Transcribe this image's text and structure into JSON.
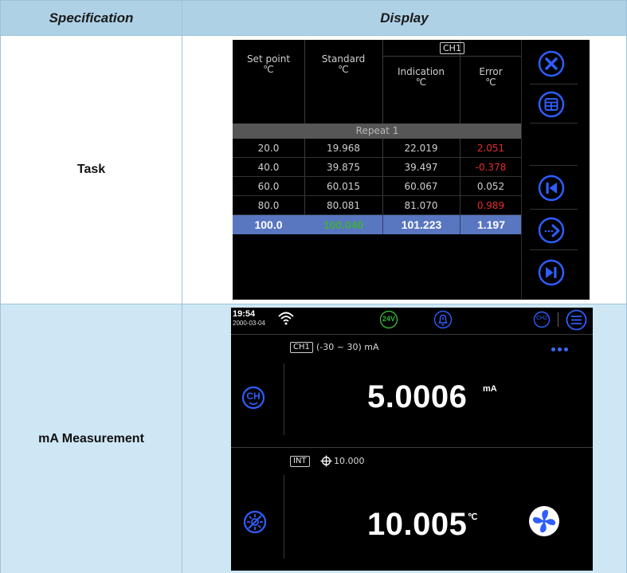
{
  "table": {
    "header_spec": "Specification",
    "header_display": "Display",
    "row1_label": "Task",
    "row2_label": "mA Measurement"
  },
  "task": {
    "columns": {
      "setpoint": "Set point",
      "setpoint_unit": "℃",
      "standard": "Standard",
      "standard_unit": "℃",
      "channel": "CH1",
      "indication": "Indication",
      "indication_unit": "℃",
      "error": "Error",
      "error_unit": "℃"
    },
    "repeat_label": "Repeat 1",
    "rows": [
      {
        "setpoint": "20.0",
        "standard": "19.968",
        "indication": "22.019",
        "error": "2.051",
        "error_negative": true
      },
      {
        "setpoint": "40.0",
        "standard": "39.875",
        "indication": "39.497",
        "error": "-0.378",
        "error_negative": true
      },
      {
        "setpoint": "60.0",
        "standard": "60.015",
        "indication": "60.067",
        "error": "0.052",
        "error_negative": false
      },
      {
        "setpoint": "80.0",
        "standard": "80.081",
        "indication": "81.070",
        "error": "0.989",
        "error_negative": true
      },
      {
        "setpoint": "100.0",
        "standard": "100.040",
        "indication": "101.223",
        "error": "1.197",
        "error_negative": false,
        "highlighted": true
      }
    ],
    "side_icons": [
      "close-icon",
      "table-icon",
      "skip-back-icon",
      "continue-icon",
      "skip-forward-icon"
    ]
  },
  "ma": {
    "time": "19:54",
    "date": "2000-03-04",
    "badge_24v": "24V",
    "ch2_label": "CH2",
    "channel_tag": "CH1",
    "range": "(-30 ~ 30) mA",
    "value": "5.0006",
    "value_unit": "mA",
    "int_tag": "INT",
    "setpoint": "10.000",
    "temp_value": "10.005",
    "temp_unit": "℃",
    "ch_icon_label": "CH"
  },
  "colors": {
    "header_bg": "#aed1e6",
    "row_alt_bg": "#cfe7f5",
    "accent_blue": "#2f5dff",
    "highlight_row": "#5976c0",
    "error_red": "#e52b2b",
    "green": "#3fae3f"
  }
}
